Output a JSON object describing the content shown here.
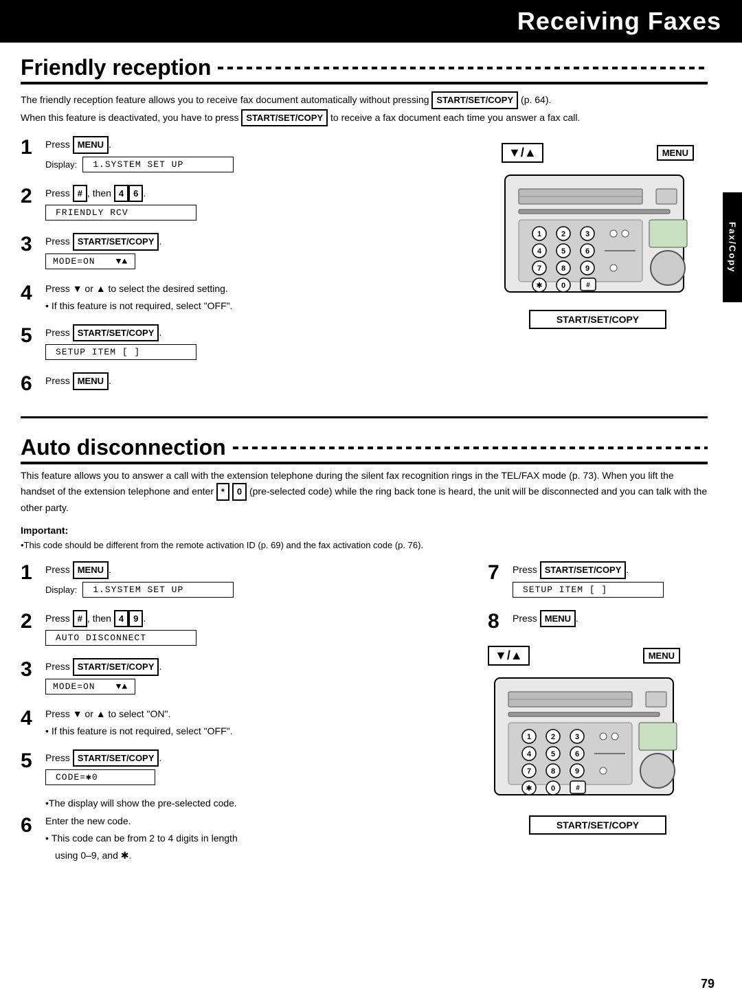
{
  "header": {
    "title": "Receiving Faxes"
  },
  "side_tab": {
    "label": "Fax/Copy"
  },
  "friendly_reception": {
    "title": "Friendly reception",
    "intro1": "The friendly reception feature allows you to receive fax document automatically without pressing",
    "intro_kbd1": "START/SET/COPY",
    "intro2": " (p. 64).",
    "intro3": "When this feature is deactivated, you have to press ",
    "intro_kbd2": "START/SET/COPY",
    "intro4": " to receive a fax document each time you answer a fax call.",
    "steps": [
      {
        "num": "1",
        "text": "Press ",
        "kbd": "MENU",
        "kbd2": null,
        "display_label": "Display:",
        "display": "1.SYSTEM  SET UP",
        "has_display": true
      },
      {
        "num": "2",
        "text": "Press ",
        "kbd": "#",
        "text2": ", then ",
        "kbd3": "4",
        "kbd4": "6",
        "display_label": null,
        "display": "FRIENDLY RCV",
        "has_display": true
      },
      {
        "num": "3",
        "text": "Press ",
        "kbd": "START/SET/COPY",
        "display": "MODE=ON",
        "has_display": true,
        "has_arrows": true
      },
      {
        "num": "4",
        "text": "Press ▼ or ▲ to select the desired setting.",
        "bullet": "If this feature is not required, select \"OFF\".",
        "has_display": false
      },
      {
        "num": "5",
        "text": "Press ",
        "kbd": "START/SET/COPY",
        "display": "SETUP ITEM [   ]",
        "has_display": true
      },
      {
        "num": "6",
        "text": "Press ",
        "kbd": "MENU",
        "has_display": false
      }
    ]
  },
  "auto_disconnection": {
    "title": "Auto disconnection",
    "intro": "This feature allows you to answer a call with the extension telephone during the silent fax recognition rings in the TEL/FAX mode (p. 73). When you lift the handset of the extension telephone and enter ",
    "kbd_star": "*",
    "kbd_zero": "0",
    "intro2": " (pre-selected code) while the ring back tone is heard, the unit will be disconnected and you can talk with the other party.",
    "important_label": "Important:",
    "important_text": "•This code should be different from the remote activation ID (p. 69) and the fax activation code (p. 76).",
    "steps_left": [
      {
        "num": "1",
        "text": "Press ",
        "kbd": "MENU",
        "display_label": "Display:",
        "display": "1.SYSTEM  SET UP",
        "has_display": true
      },
      {
        "num": "2",
        "text": "Press ",
        "kbd": "#",
        "text2": ", then ",
        "kbd3": "4",
        "kbd4": "9",
        "display": "AUTO DISCONNECT",
        "has_display": true
      },
      {
        "num": "3",
        "text": "Press ",
        "kbd": "START/SET/COPY",
        "display": "MODE=ON",
        "has_display": true,
        "has_arrows": true
      },
      {
        "num": "4",
        "text": "Press ▼ or ▲ to select \"ON\".",
        "bullet": "If this feature is not required, select \"OFF\".",
        "has_display": false
      },
      {
        "num": "5",
        "text": "Press ",
        "kbd": "START/SET/COPY",
        "display": "CODE=✱0",
        "has_display": true
      },
      {
        "num": "6",
        "text": "Enter the new code.",
        "bullets": [
          "This code can be from 2 to 4 digits in length",
          "using 0–9, and ✱."
        ],
        "has_display": false
      }
    ],
    "steps_right": [
      {
        "num": "7",
        "text": "Press ",
        "kbd": "START/SET/COPY",
        "display": "SETUP ITEM [   ]",
        "has_display": true
      },
      {
        "num": "8",
        "text": "Press ",
        "kbd": "MENU",
        "has_display": false
      }
    ]
  },
  "page_num": "79"
}
